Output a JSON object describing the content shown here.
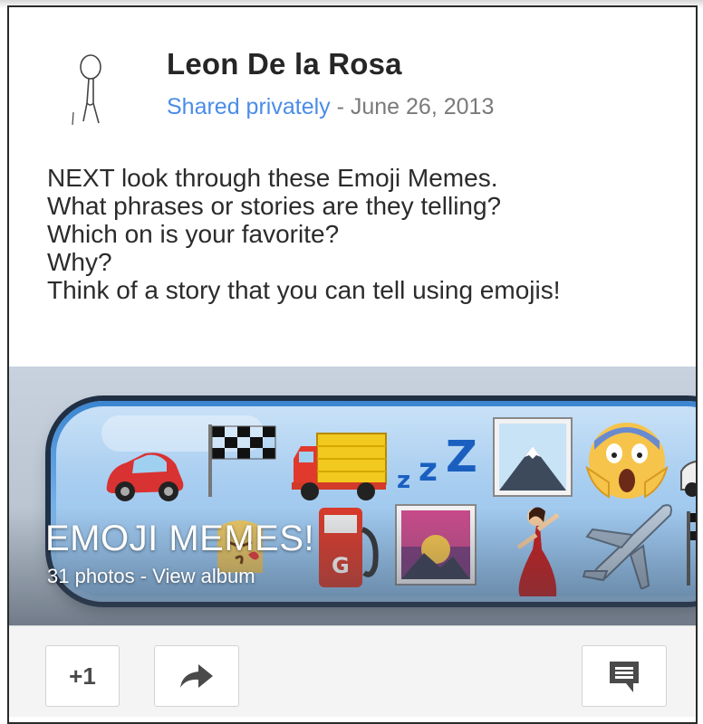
{
  "post": {
    "author": "Leon De la Rosa",
    "visibility": "Shared privately",
    "separator": " - ",
    "date": "June 26, 2013",
    "text_lines": [
      "NEXT look through these Emoji Memes.",
      "What phrases or stories are they telling?",
      "Which on is your favorite?",
      "Why?",
      "Think of a story that you can tell using emojis!"
    ]
  },
  "album": {
    "title": "EMOJI MEMES!",
    "photo_count": "31 photos",
    "link_separator": " - ",
    "view_label": "View album",
    "emoji_row_top": [
      "red-car",
      "checkered-flag",
      "delivery-truck",
      "zzz",
      "mount-fuji",
      "screaming-face"
    ],
    "emoji_row_bottom": [
      "kissing-face",
      "fuel-pump",
      "sunrise-over-mountains",
      "dancer",
      "airplane"
    ]
  },
  "actions": {
    "plus_one_label": "+1",
    "share_icon": "share-arrow-icon",
    "comment_icon": "comment-icon"
  },
  "colors": {
    "link_blue": "#4a8ce8",
    "author_text": "#262626",
    "meta_gray": "#7a7a7a"
  }
}
